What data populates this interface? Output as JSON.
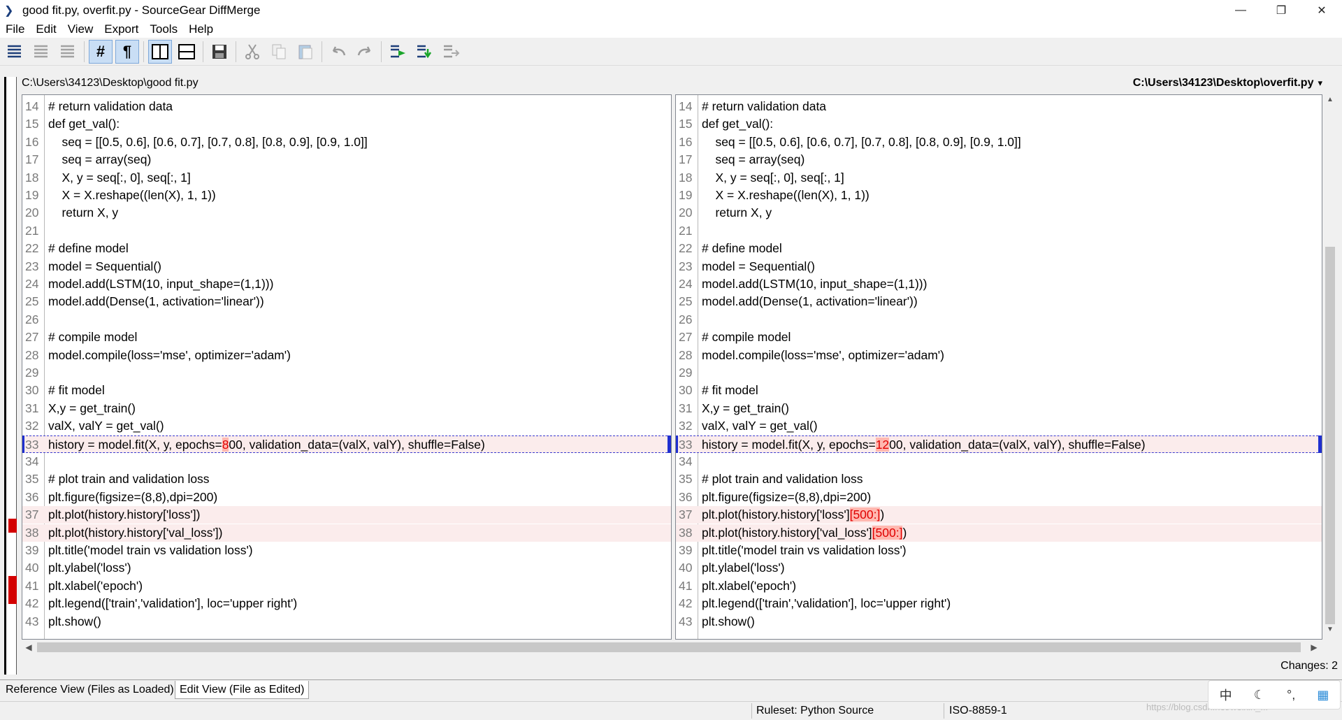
{
  "window": {
    "title": "good fit.py, overfit.py - SourceGear DiffMerge",
    "controls": {
      "minimize": "—",
      "maximize": "❐",
      "close": "✕"
    }
  },
  "menu": [
    "File",
    "Edit",
    "View",
    "Export",
    "Tools",
    "Help"
  ],
  "toolbar": {
    "buttons": [
      "align-left-icon",
      "align-center-icon",
      "align-right-icon",
      "line-numbers-icon",
      "pilcrow-icon",
      "two-panel-icon",
      "three-panel-icon",
      "save-icon",
      "cut-icon",
      "copy-icon",
      "paste-icon",
      "undo-icon",
      "redo-icon",
      "next-change-icon",
      "prev-change-icon",
      "export-icon"
    ],
    "line_numbers_glyph": "#",
    "pilcrow_glyph": "¶"
  },
  "left": {
    "path": "C:\\Users\\34123\\Desktop\\good fit.py"
  },
  "right": {
    "path": "C:\\Users\\34123\\Desktop\\overfit.py",
    "dropdown": "▾"
  },
  "lines": [
    {
      "n": "14",
      "left": "# return validation data",
      "right": "# return validation data"
    },
    {
      "n": "15",
      "left": "def get_val():",
      "right": "def get_val():"
    },
    {
      "n": "16",
      "left": "    seq = [[0.5, 0.6], [0.6, 0.7], [0.7, 0.8], [0.8, 0.9], [0.9, 1.0]]",
      "right": "    seq = [[0.5, 0.6], [0.6, 0.7], [0.7, 0.8], [0.8, 0.9], [0.9, 1.0]]"
    },
    {
      "n": "17",
      "left": "    seq = array(seq)",
      "right": "    seq = array(seq)"
    },
    {
      "n": "18",
      "left": "    X, y = seq[:, 0], seq[:, 1]",
      "right": "    X, y = seq[:, 0], seq[:, 1]"
    },
    {
      "n": "19",
      "left": "    X = X.reshape((len(X), 1, 1))",
      "right": "    X = X.reshape((len(X), 1, 1))"
    },
    {
      "n": "20",
      "left": "    return X, y",
      "right": "    return X, y"
    },
    {
      "n": "21",
      "left": "",
      "right": ""
    },
    {
      "n": "22",
      "left": "# define model",
      "right": "# define model"
    },
    {
      "n": "23",
      "left": "model = Sequential()",
      "right": "model = Sequential()"
    },
    {
      "n": "24",
      "left": "model.add(LSTM(10, input_shape=(1,1)))",
      "right": "model.add(LSTM(10, input_shape=(1,1)))"
    },
    {
      "n": "25",
      "left": "model.add(Dense(1, activation='linear'))",
      "right": "model.add(Dense(1, activation='linear'))"
    },
    {
      "n": "26",
      "left": "",
      "right": ""
    },
    {
      "n": "27",
      "left": "# compile model",
      "right": "# compile model"
    },
    {
      "n": "28",
      "left": "model.compile(loss='mse', optimizer='adam')",
      "right": "model.compile(loss='mse', optimizer='adam')"
    },
    {
      "n": "29",
      "left": "",
      "right": ""
    },
    {
      "n": "30",
      "left": "# fit model",
      "right": "# fit model"
    },
    {
      "n": "31",
      "left": "X,y = get_train()",
      "right": "X,y = get_train()"
    },
    {
      "n": "32",
      "left": "valX, valY = get_val()",
      "right": "valX, valY = get_val()"
    },
    {
      "n": "33",
      "left": "history = model.fit(X, y, epochs=800, validation_data=(valX, valY), shuffle=False)",
      "right": "history = model.fit(X, y, epochs=1200, validation_data=(valX, valY), shuffle=False)",
      "left_parts": [
        "history = model.fit(X, y, epochs=",
        "8",
        "00, validation_data=(valX, valY), shuffle=False)"
      ],
      "right_parts": [
        "history = model.fit(X, y, epochs=",
        "12",
        "00, validation_data=(valX, valY), shuffle=False)"
      ]
    },
    {
      "n": "34",
      "left": "",
      "right": ""
    },
    {
      "n": "35",
      "left": "# plot train and validation loss",
      "right": "# plot train and validation loss"
    },
    {
      "n": "36",
      "left": "plt.figure(figsize=(8,8),dpi=200)",
      "right": "plt.figure(figsize=(8,8),dpi=200)"
    },
    {
      "n": "37",
      "left": "plt.plot(history.history['loss'])",
      "right": "plt.plot(history.history['loss'][500:])",
      "right_parts": [
        "plt.plot(history.history['loss']",
        "[500:]",
        ")"
      ]
    },
    {
      "n": "38",
      "left": "plt.plot(history.history['val_loss'])",
      "right": "plt.plot(history.history['val_loss'][500:])",
      "right_parts": [
        "plt.plot(history.history['val_loss']",
        "[500:]",
        ")"
      ]
    },
    {
      "n": "39",
      "left": "plt.title('model train vs validation loss')",
      "right": "plt.title('model train vs validation loss')"
    },
    {
      "n": "40",
      "left": "plt.ylabel('loss')",
      "right": "plt.ylabel('loss')"
    },
    {
      "n": "41",
      "left": "plt.xlabel('epoch')",
      "right": "plt.xlabel('epoch')"
    },
    {
      "n": "42",
      "left": "plt.legend(['train','validation'], loc='upper right')",
      "right": "plt.legend(['train','validation'], loc='upper right')"
    },
    {
      "n": "43",
      "left": "plt.show()",
      "right": "plt.show()"
    }
  ],
  "changes_label": "Changes: 2",
  "tabs": [
    "Reference View (Files as Loaded)",
    "Edit View (File as Edited)"
  ],
  "status": {
    "ruleset": "Ruleset: Python Source",
    "encoding": "ISO-8859-1"
  },
  "ime": [
    "中",
    "☾",
    "°,",
    "▦"
  ],
  "watermark": "https://blog.csdn.net/weixin_..."
}
